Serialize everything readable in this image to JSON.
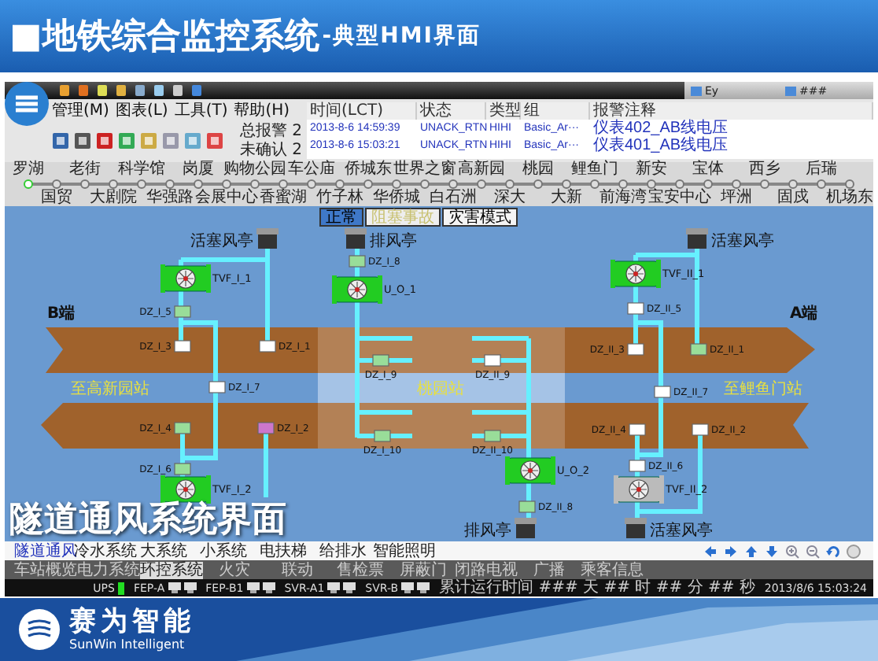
{
  "slide_title": {
    "main": "■地铁综合监控系统",
    "sub": "-典型HMI界面"
  },
  "hmi": {
    "top_tabs": [
      "Ey",
      "###"
    ],
    "menu": [
      "管理(M)",
      "图表(L)",
      "工具(T)",
      "帮助(H)"
    ],
    "alarm_summary": [
      {
        "label": "总报警",
        "value": "2"
      },
      {
        "label": "未确认",
        "value": "2"
      }
    ],
    "alarm_table": {
      "columns": [
        "时间(LCT)",
        "状态",
        "类型",
        "组",
        "报警注释"
      ],
      "rows": [
        [
          "2013-8-6 14:59:39",
          "UNACK_RTN",
          "HIHI",
          "Basic_Ar···",
          "仪表402_AB线电压"
        ],
        [
          "2013-8-6 15:03:21",
          "UNACK_RTN",
          "HIHI",
          "Basic_Ar···",
          "仪表401_AB线电压"
        ]
      ]
    },
    "stations": [
      {
        "name": "罗湖",
        "selected": true
      },
      {
        "name": "国贸",
        "selected": false
      },
      {
        "name": "老街",
        "selected": false
      },
      {
        "name": "大剧院",
        "selected": false
      },
      {
        "name": "科学馆",
        "selected": false
      },
      {
        "name": "华强路",
        "selected": false
      },
      {
        "name": "岗厦",
        "selected": false
      },
      {
        "name": "会展中心",
        "selected": false
      },
      {
        "name": "购物公园",
        "selected": false
      },
      {
        "name": "香蜜湖",
        "selected": false
      },
      {
        "name": "车公庙",
        "selected": false
      },
      {
        "name": "竹子林",
        "selected": false
      },
      {
        "name": "侨城东",
        "selected": false
      },
      {
        "name": "华侨城",
        "selected": false
      },
      {
        "name": "世界之窗",
        "selected": false
      },
      {
        "name": "白石洲",
        "selected": false
      },
      {
        "name": "高新园",
        "selected": false
      },
      {
        "name": "深大",
        "selected": false
      },
      {
        "name": "桃园",
        "selected": false
      },
      {
        "name": "大新",
        "selected": false
      },
      {
        "name": "鲤鱼门",
        "selected": false
      },
      {
        "name": "前海湾",
        "selected": false
      },
      {
        "name": "新安",
        "selected": false
      },
      {
        "name": "宝安中心",
        "selected": false
      },
      {
        "name": "宝体",
        "selected": false
      },
      {
        "name": "坪洲",
        "selected": false
      },
      {
        "name": "西乡",
        "selected": false
      },
      {
        "name": "固戍",
        "selected": false
      },
      {
        "name": "后瑞",
        "selected": false
      },
      {
        "name": "机场东",
        "selected": false
      }
    ],
    "modes": [
      {
        "label": "正常",
        "selected": true,
        "disabled": false
      },
      {
        "label": "阻塞事故",
        "selected": false,
        "disabled": true
      },
      {
        "label": "灾害模式",
        "selected": false,
        "disabled": false
      }
    ],
    "diagram": {
      "ends": [
        "B端",
        "A端"
      ],
      "track_labels": [
        "至高新园站",
        "桃园站",
        "至鲤鱼门站"
      ],
      "vents": [
        {
          "label": "活塞风亭"
        },
        {
          "label": "排风亭"
        },
        {
          "label": "活塞风亭"
        },
        {
          "label": "排风亭"
        },
        {
          "label": "活塞风亭"
        }
      ],
      "fans": [
        {
          "label": "TVF_I_1",
          "color": "#22cc22"
        },
        {
          "label": "U_O_1",
          "color": "#22cc22"
        },
        {
          "label": "TVF_II_1",
          "color": "#22cc22"
        },
        {
          "label": "U_O_2",
          "color": "#22cc22"
        },
        {
          "label": "TVF_I_2",
          "color": "#22cc22"
        },
        {
          "label": "TVF_II_2",
          "color": "#bbbbbb"
        }
      ],
      "dampers": [
        {
          "label": "DZ_I_5",
          "color": "#99dd99"
        },
        {
          "label": "DZ_I_3",
          "color": "#ffffff"
        },
        {
          "label": "DZ_I_1",
          "color": "#ffffff"
        },
        {
          "label": "DZ_I_8",
          "color": "#99dd99"
        },
        {
          "label": "DZ_I_9",
          "color": "#99dd99"
        },
        {
          "label": "DZ_II_9",
          "color": "#ffffff"
        },
        {
          "label": "DZ_II_5",
          "color": "#ffffff"
        },
        {
          "label": "DZ_II_3",
          "color": "#ffffff"
        },
        {
          "label": "DZ_II_1",
          "color": "#99dd99"
        },
        {
          "label": "DZ_I_7",
          "color": "#ffffff"
        },
        {
          "label": "DZ_II_7",
          "color": "#ffffff"
        },
        {
          "label": "DZ_I_4",
          "color": "#99dd99"
        },
        {
          "label": "DZ_I_2",
          "color": "#cc77cc"
        },
        {
          "label": "DZ_I_10",
          "color": "#99dd99"
        },
        {
          "label": "DZ_II_10",
          "color": "#99dd99"
        },
        {
          "label": "DZ_II_4",
          "color": "#ffffff"
        },
        {
          "label": "DZ_II_2",
          "color": "#ffffff"
        },
        {
          "label": "DZ_I_6",
          "color": "#99dd99"
        },
        {
          "label": "DZ_II_6",
          "color": "#ffffff"
        },
        {
          "label": "DZ_II_8",
          "color": "#99dd99"
        }
      ]
    },
    "overlay_caption": "隧道通风系统界面",
    "system_tabs": [
      {
        "label": "隧道通风",
        "selected": true
      },
      {
        "label": "冷水系统",
        "selected": false
      },
      {
        "label": "大系统",
        "selected": false
      },
      {
        "label": "小系统",
        "selected": false
      },
      {
        "label": "电扶梯",
        "selected": false
      },
      {
        "label": "给排水",
        "selected": false
      },
      {
        "label": "智能照明",
        "selected": false
      }
    ],
    "subsystem_tabs": [
      {
        "label": "车站概览",
        "selected": false
      },
      {
        "label": "电力系统",
        "selected": false
      },
      {
        "label": "环控系统",
        "selected": true
      },
      {
        "label": "火灾",
        "selected": false
      },
      {
        "label": "联动",
        "selected": false
      },
      {
        "label": "售检票",
        "selected": false
      },
      {
        "label": "屏蔽门",
        "selected": false
      },
      {
        "label": "闭路电视",
        "selected": false
      },
      {
        "label": "广播",
        "selected": false
      },
      {
        "label": "乘客信息",
        "selected": false
      }
    ],
    "status_bar": {
      "items": [
        {
          "label": "UPS",
          "kind": "lamp"
        },
        {
          "label": "FEP-A",
          "kind": "servers"
        },
        {
          "label": "FEP-B1",
          "kind": "servers"
        },
        {
          "label": "SVR-A1",
          "kind": "servers"
        },
        {
          "label": "SVR-B",
          "kind": "servers"
        }
      ],
      "runtime": "累计运行时间 ### 天 ## 时 ## 分 ## 秒",
      "datetime": "2013/8/6 15:03:24"
    }
  },
  "footer": {
    "company": "赛为智能",
    "company_en": "SunWin Intelligent"
  }
}
